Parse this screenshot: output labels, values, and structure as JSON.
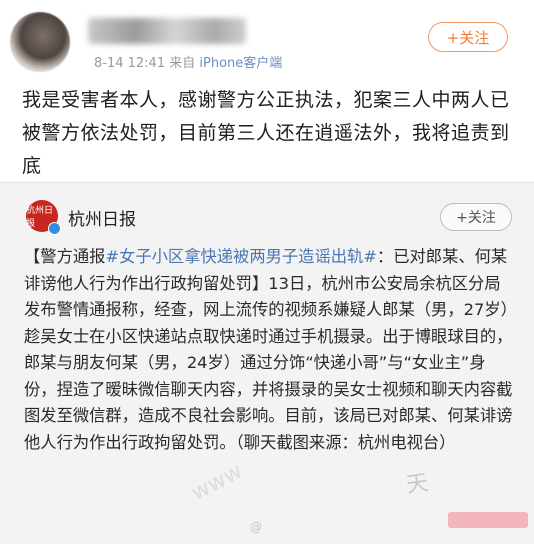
{
  "post": {
    "meta_time": "8-14 12:41",
    "meta_via": "来自",
    "meta_source": "iPhone客户端",
    "follow_label": "+关注",
    "text": "我是受害者本人，感谢警方公正执法，犯案三人中两人已被警方依法处罚，目前第三人还在逍遥法外，我将追责到底"
  },
  "repost": {
    "source_name": "杭州日报",
    "source_logo_text": "杭州日报",
    "follow_label": "+关注",
    "text_prefix": "【警方通报",
    "hashtag": "#女子小区拿快递被两男子造谣出轨#",
    "text_body": "：已对郎某、何某诽谤他人行为作出行政拘留处罚】13日，杭州市公安局余杭区分局发布警情通报称，经查，网上流传的视频系嫌疑人郎某（男，27岁）趁吴女士在小区快递站点取快递时通过手机摄录。出于博眼球目的，郎某与朋友何某（男，24岁）通过分饰“快递小哥”与“女业主”身份，捏造了暧昧微信聊天内容，并将摄录的吴女士视频和聊天内容截图发至微信群，造成不良社会影响。目前，该局已对郎某、何某诽谤他人行为作出行政拘留处罚。（聊天截图来源：杭州电视台）"
  },
  "watermarks": {
    "diagonal": "www",
    "corner": "天",
    "bottom": "@"
  },
  "colors": {
    "follow_orange": "#f07e33",
    "link_blue": "#4a77b4",
    "repost_bg": "#f3f3f3",
    "logo_red": "#c7271f"
  }
}
